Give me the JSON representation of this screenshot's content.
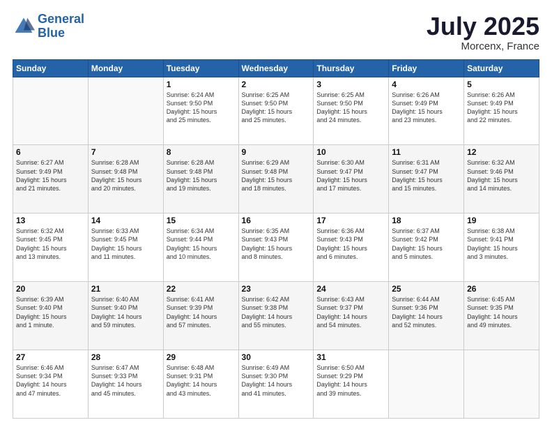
{
  "header": {
    "logo_line1": "General",
    "logo_line2": "Blue",
    "month": "July 2025",
    "location": "Morcenx, France"
  },
  "days_of_week": [
    "Sunday",
    "Monday",
    "Tuesday",
    "Wednesday",
    "Thursday",
    "Friday",
    "Saturday"
  ],
  "weeks": [
    [
      {
        "day": "",
        "info": ""
      },
      {
        "day": "",
        "info": ""
      },
      {
        "day": "1",
        "info": "Sunrise: 6:24 AM\nSunset: 9:50 PM\nDaylight: 15 hours\nand 25 minutes."
      },
      {
        "day": "2",
        "info": "Sunrise: 6:25 AM\nSunset: 9:50 PM\nDaylight: 15 hours\nand 25 minutes."
      },
      {
        "day": "3",
        "info": "Sunrise: 6:25 AM\nSunset: 9:50 PM\nDaylight: 15 hours\nand 24 minutes."
      },
      {
        "day": "4",
        "info": "Sunrise: 6:26 AM\nSunset: 9:49 PM\nDaylight: 15 hours\nand 23 minutes."
      },
      {
        "day": "5",
        "info": "Sunrise: 6:26 AM\nSunset: 9:49 PM\nDaylight: 15 hours\nand 22 minutes."
      }
    ],
    [
      {
        "day": "6",
        "info": "Sunrise: 6:27 AM\nSunset: 9:49 PM\nDaylight: 15 hours\nand 21 minutes."
      },
      {
        "day": "7",
        "info": "Sunrise: 6:28 AM\nSunset: 9:48 PM\nDaylight: 15 hours\nand 20 minutes."
      },
      {
        "day": "8",
        "info": "Sunrise: 6:28 AM\nSunset: 9:48 PM\nDaylight: 15 hours\nand 19 minutes."
      },
      {
        "day": "9",
        "info": "Sunrise: 6:29 AM\nSunset: 9:48 PM\nDaylight: 15 hours\nand 18 minutes."
      },
      {
        "day": "10",
        "info": "Sunrise: 6:30 AM\nSunset: 9:47 PM\nDaylight: 15 hours\nand 17 minutes."
      },
      {
        "day": "11",
        "info": "Sunrise: 6:31 AM\nSunset: 9:47 PM\nDaylight: 15 hours\nand 15 minutes."
      },
      {
        "day": "12",
        "info": "Sunrise: 6:32 AM\nSunset: 9:46 PM\nDaylight: 15 hours\nand 14 minutes."
      }
    ],
    [
      {
        "day": "13",
        "info": "Sunrise: 6:32 AM\nSunset: 9:45 PM\nDaylight: 15 hours\nand 13 minutes."
      },
      {
        "day": "14",
        "info": "Sunrise: 6:33 AM\nSunset: 9:45 PM\nDaylight: 15 hours\nand 11 minutes."
      },
      {
        "day": "15",
        "info": "Sunrise: 6:34 AM\nSunset: 9:44 PM\nDaylight: 15 hours\nand 10 minutes."
      },
      {
        "day": "16",
        "info": "Sunrise: 6:35 AM\nSunset: 9:43 PM\nDaylight: 15 hours\nand 8 minutes."
      },
      {
        "day": "17",
        "info": "Sunrise: 6:36 AM\nSunset: 9:43 PM\nDaylight: 15 hours\nand 6 minutes."
      },
      {
        "day": "18",
        "info": "Sunrise: 6:37 AM\nSunset: 9:42 PM\nDaylight: 15 hours\nand 5 minutes."
      },
      {
        "day": "19",
        "info": "Sunrise: 6:38 AM\nSunset: 9:41 PM\nDaylight: 15 hours\nand 3 minutes."
      }
    ],
    [
      {
        "day": "20",
        "info": "Sunrise: 6:39 AM\nSunset: 9:40 PM\nDaylight: 15 hours\nand 1 minute."
      },
      {
        "day": "21",
        "info": "Sunrise: 6:40 AM\nSunset: 9:40 PM\nDaylight: 14 hours\nand 59 minutes."
      },
      {
        "day": "22",
        "info": "Sunrise: 6:41 AM\nSunset: 9:39 PM\nDaylight: 14 hours\nand 57 minutes."
      },
      {
        "day": "23",
        "info": "Sunrise: 6:42 AM\nSunset: 9:38 PM\nDaylight: 14 hours\nand 55 minutes."
      },
      {
        "day": "24",
        "info": "Sunrise: 6:43 AM\nSunset: 9:37 PM\nDaylight: 14 hours\nand 54 minutes."
      },
      {
        "day": "25",
        "info": "Sunrise: 6:44 AM\nSunset: 9:36 PM\nDaylight: 14 hours\nand 52 minutes."
      },
      {
        "day": "26",
        "info": "Sunrise: 6:45 AM\nSunset: 9:35 PM\nDaylight: 14 hours\nand 49 minutes."
      }
    ],
    [
      {
        "day": "27",
        "info": "Sunrise: 6:46 AM\nSunset: 9:34 PM\nDaylight: 14 hours\nand 47 minutes."
      },
      {
        "day": "28",
        "info": "Sunrise: 6:47 AM\nSunset: 9:33 PM\nDaylight: 14 hours\nand 45 minutes."
      },
      {
        "day": "29",
        "info": "Sunrise: 6:48 AM\nSunset: 9:31 PM\nDaylight: 14 hours\nand 43 minutes."
      },
      {
        "day": "30",
        "info": "Sunrise: 6:49 AM\nSunset: 9:30 PM\nDaylight: 14 hours\nand 41 minutes."
      },
      {
        "day": "31",
        "info": "Sunrise: 6:50 AM\nSunset: 9:29 PM\nDaylight: 14 hours\nand 39 minutes."
      },
      {
        "day": "",
        "info": ""
      },
      {
        "day": "",
        "info": ""
      }
    ]
  ]
}
